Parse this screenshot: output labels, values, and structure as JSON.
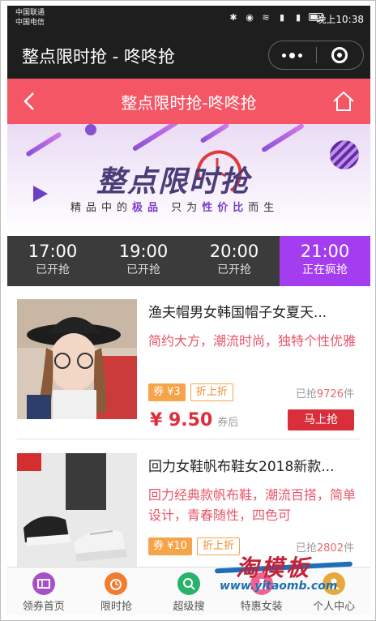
{
  "status_bar": {
    "carrier1": "中国联通",
    "carrier2": "中国电信",
    "time": "晚上10:38"
  },
  "app_bar": {
    "title": "整点限时抢 - 咚咚抢"
  },
  "nav": {
    "title": "整点限时抢-咚咚抢"
  },
  "banner": {
    "title": "整点限时抢",
    "sub_prefix": "精品中的",
    "sub_hl1": "极品",
    "sub_mid": "只为",
    "sub_hl2": "性价比",
    "sub_suffix": "而生"
  },
  "time_tabs": [
    {
      "time": "17:00",
      "status": "已开抢",
      "active": false
    },
    {
      "time": "19:00",
      "status": "已开抢",
      "active": false
    },
    {
      "time": "20:00",
      "status": "已开抢",
      "active": false
    },
    {
      "time": "21:00",
      "status": "正在疯抢",
      "active": true
    }
  ],
  "products": [
    {
      "name": "渔夫帽男女韩国帽子女夏天...",
      "desc": "简约大方，潮流时尚，独特个性优雅",
      "coupon": "券 ¥3",
      "discount": "折上折",
      "sold_prefix": "已抢",
      "sold_count": "9726",
      "sold_suffix": "件",
      "price": "¥ 9.50",
      "price_after": "券后",
      "buy": "马上抢"
    },
    {
      "name": "回力女鞋帆布鞋女2018新款...",
      "desc": "回力经典款帆布鞋，潮流百搭，简单设计，青春随性，四色可",
      "coupon": "券 ¥10",
      "discount": "折上折",
      "sold_prefix": "已抢",
      "sold_count": "2802",
      "sold_suffix": "件",
      "price": "",
      "price_after": "",
      "buy": ""
    }
  ],
  "tabbar": [
    {
      "label": "领券首页",
      "icon": "coupon-icon",
      "color": "#a64fc8"
    },
    {
      "label": "限时抢",
      "icon": "alarm-clock-icon",
      "color": "#f47a30"
    },
    {
      "label": "超级搜",
      "icon": "search-icon",
      "color": "#27b36b"
    },
    {
      "label": "特惠女装",
      "icon": "dress-icon",
      "color": "#f06292"
    },
    {
      "label": "个人中心",
      "icon": "user-icon",
      "color": "#e8a93c"
    }
  ],
  "watermark": {
    "big": "淘模板",
    "url": "www.yitaomb.com"
  },
  "colors": {
    "nav_red": "#f45665",
    "tab_active": "#a43cf0",
    "price_red": "#e02d3c",
    "coupon_orange": "#f6a44a"
  }
}
